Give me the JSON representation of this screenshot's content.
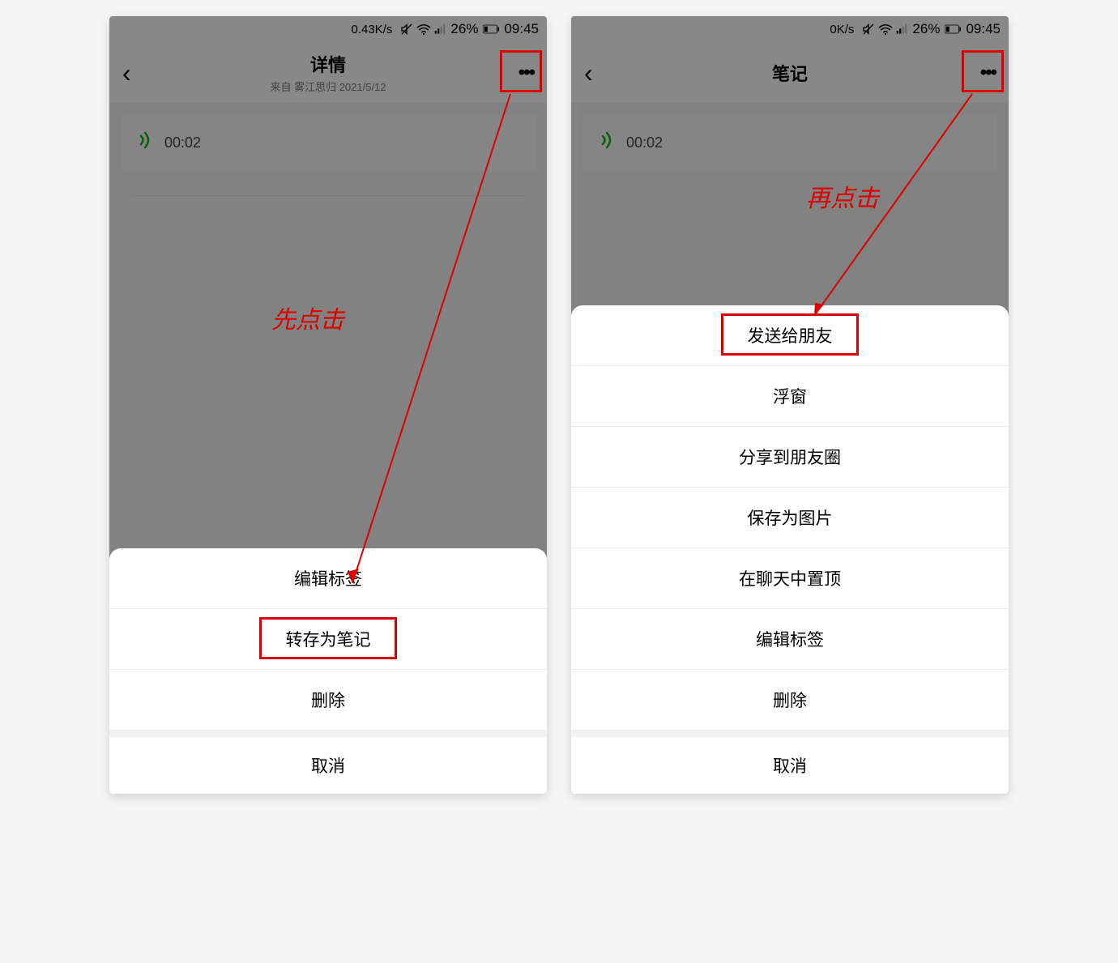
{
  "left": {
    "status": {
      "speed": "0.43K/s",
      "battery": "26%",
      "time": "09:45"
    },
    "nav": {
      "title": "详情",
      "subtitle": "来自 雾江思归 2021/5/12"
    },
    "voice_time": "00:02",
    "annotation": "先点击",
    "sheet": {
      "items": [
        "编辑标签",
        "转存为笔记",
        "删除"
      ],
      "cancel": "取消"
    }
  },
  "right": {
    "status": {
      "speed": "0K/s",
      "battery": "26%",
      "time": "09:45"
    },
    "nav": {
      "title": "笔记",
      "subtitle": ""
    },
    "voice_time": "00:02",
    "annotation": "再点击",
    "sheet": {
      "items": [
        "发送给朋友",
        "浮窗",
        "分享到朋友圈",
        "保存为图片",
        "在聊天中置顶",
        "编辑标签",
        "删除"
      ],
      "cancel": "取消"
    }
  },
  "highlight_left_item": 1,
  "highlight_right_item": 0
}
